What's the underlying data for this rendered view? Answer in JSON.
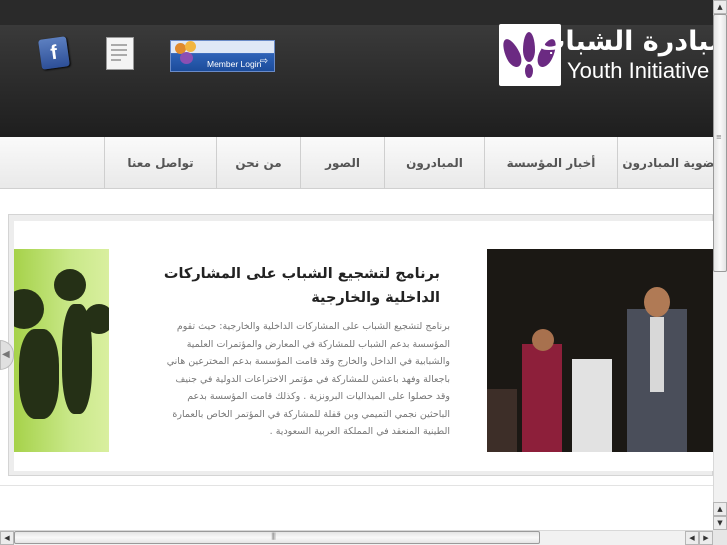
{
  "header": {
    "logo_arabic": "مبادرة الشباب",
    "logo_english": "Youth Initiative",
    "facebook_icon": "facebook-icon",
    "document_icon": "document-icon",
    "member_login_label": "Member Login"
  },
  "nav": {
    "items": [
      {
        "label": "عضوية المبادرون"
      },
      {
        "label": "أخبار المؤسسة"
      },
      {
        "label": "المبادرون"
      },
      {
        "label": "الصور"
      },
      {
        "label": "من نحن"
      },
      {
        "label": "تواصل معنا"
      }
    ]
  },
  "article": {
    "title": "برنامج لتشجيع الشباب على المشاركات الداخلية والخارجية",
    "body": "برنامج لتشجيع الشباب على المشاركات الداخلية والخارجية: حيث تقوم المؤسسة بدعم الشباب للمشاركة في المعارض والمؤتمرات العلمية والشبابية في الداخل والخارج وقد قامت المؤسسة بدعم المخترعين هاني باجعالة وفهد باعشن للمشاركة في مؤتمر الاختراعات الدولية في جنيف وقد حصلوا على الميداليات البرونزية . وكذلك قامت المؤسسة بدعم الباحثين نجمي التميمي وبن قفلة للمشاركة في المؤتمر الخاص بالعمارة الطينية المنعقد في المملكة العربية السعودية ."
  },
  "colors": {
    "header_bg": "#2a2a2a",
    "logo_purple": "#6b2a82",
    "login_blue": "#1c4c9b"
  }
}
